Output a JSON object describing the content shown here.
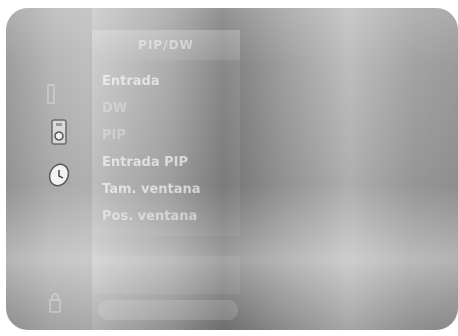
{
  "menu": {
    "title": "PIP/DW",
    "items": [
      {
        "label": "Entrada"
      },
      {
        "label": "DW"
      },
      {
        "label": "PIP"
      },
      {
        "label": "Entrada PIP"
      },
      {
        "label": "Tam. ventana"
      },
      {
        "label": "Pos. ventana"
      }
    ]
  },
  "icons": {
    "left": [
      "picture-icon",
      "speaker-icon",
      "clock-icon",
      "lock-icon"
    ]
  }
}
